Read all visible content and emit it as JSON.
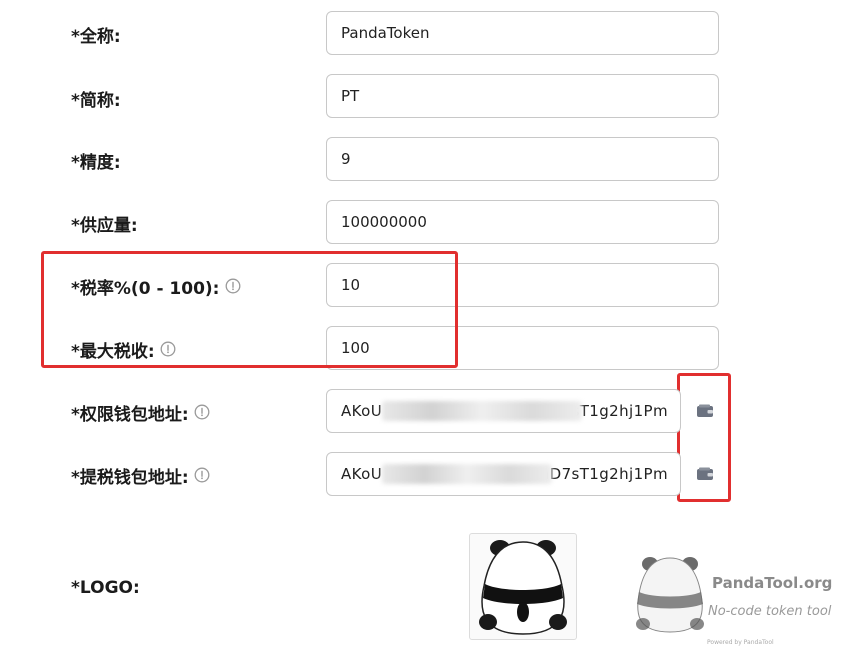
{
  "form": {
    "full_name": {
      "label": "*全称:",
      "value": "PandaToken"
    },
    "symbol": {
      "label": "*简称:",
      "value": "PT"
    },
    "decimals": {
      "label": "*精度:",
      "value": "9"
    },
    "supply": {
      "label": "*供应量:",
      "value": "100000000"
    },
    "tax_rate": {
      "label": "*税率%(0 - 100):",
      "value": "10"
    },
    "max_tax": {
      "label": "*最大税收:",
      "value": "100"
    },
    "authority_wallet": {
      "label": "*权限钱包地址:",
      "value": "AKoU",
      "value_end": "sT1g2hj1Pm"
    },
    "tax_wallet": {
      "label": "*提税钱包地址:",
      "value": "AKoU",
      "value_end": "mD7sT1g2hj1Pm"
    },
    "logo": {
      "label": "*LOGO:"
    }
  },
  "watermark": {
    "brand": "PandaTool.org",
    "tagline": "No-code token tool",
    "small": "Powered by PandaTool"
  },
  "colors": {
    "highlight": "#e12f2f",
    "input_border": "#c8c8c8",
    "icon_gray": "#9a9a9a",
    "wallet_icon": "#6b7280"
  },
  "icons": {
    "help": "question-circle-icon",
    "wallet": "wallet-icon"
  }
}
